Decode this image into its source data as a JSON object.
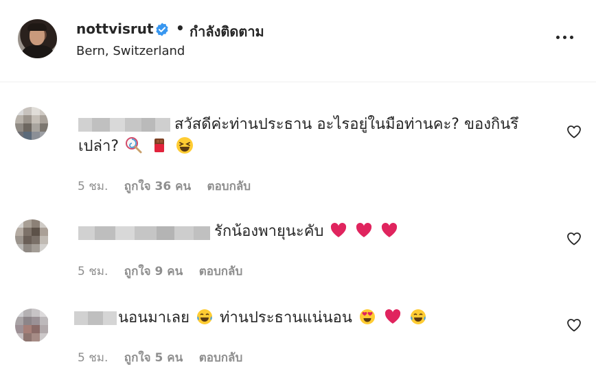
{
  "header": {
    "username": "nottvisrut",
    "separator": "•",
    "follow_status": "กำลังติดตาม",
    "location": "Bern, Switzerland"
  },
  "comments": [
    {
      "text_line1": "สวัสดีค่ะท่านประธาน อะไรอยู่ในมือท่านคะ? ของกินรึ",
      "text_line2": "เปล่า?",
      "time": "5 ชม.",
      "likes": "ถูกใจ 36 คน",
      "reply": "ตอบกลับ"
    },
    {
      "text": "รักน้องพายุนะคับ",
      "time": "5 ชม.",
      "likes": "ถูกใจ 9 คน",
      "reply": "ตอบกลับ"
    },
    {
      "text_part1": "นอนมาเลย",
      "text_part2": "ท่านประธานแน่นอน",
      "time": "5 ชม.",
      "likes": "ถูกใจ 5 คน",
      "reply": "ตอบกลับ"
    }
  ],
  "icons": {
    "verified": "verified-badge-icon",
    "more": "more-options-icon",
    "like": "heart-outline-icon"
  },
  "colors": {
    "text": "#262626",
    "secondary": "#8e8e8e",
    "verified": "#3897f0",
    "heart_emoji": "#e0245e"
  }
}
